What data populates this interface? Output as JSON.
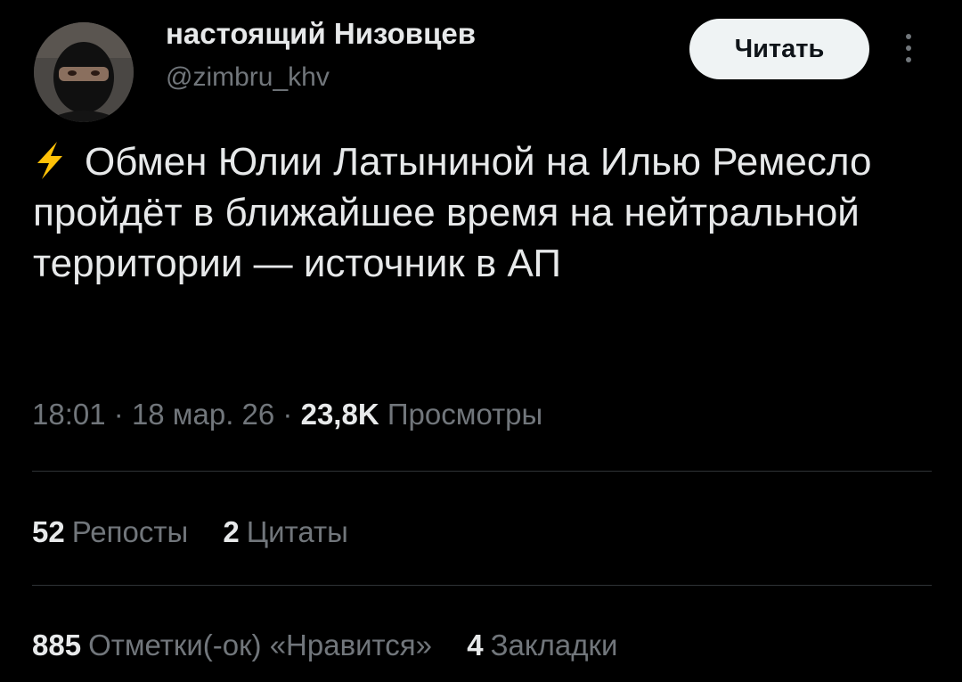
{
  "author": {
    "display_name": "настоящий Низовцев",
    "handle": "@zimbru_khv"
  },
  "follow_button": {
    "label": "Читать"
  },
  "tweet": {
    "icon": "lightning-bolt-icon",
    "text": "Обмен Юлии Латыниной на Илью Ремесло пройдёт в ближайшее время на нейтральной территории — источник в АП"
  },
  "meta": {
    "time": "18:01",
    "separator": "·",
    "date": "18 мар. 26",
    "views_count": "23,8K",
    "views_label": "Просмотры"
  },
  "engagement_row1": [
    {
      "count": "52",
      "label": "Репосты"
    },
    {
      "count": "2",
      "label": "Цитаты"
    }
  ],
  "engagement_row2": [
    {
      "count": "885",
      "label": "Отметки(-ок) «Нравится»"
    },
    {
      "count": "4",
      "label": "Закладки"
    }
  ],
  "colors": {
    "background": "#000000",
    "primary_text": "#e7e9ea",
    "secondary_text": "#71767b",
    "divider": "#2f3336",
    "follow_button_bg": "#eff3f4",
    "bolt": "#ffc107"
  }
}
